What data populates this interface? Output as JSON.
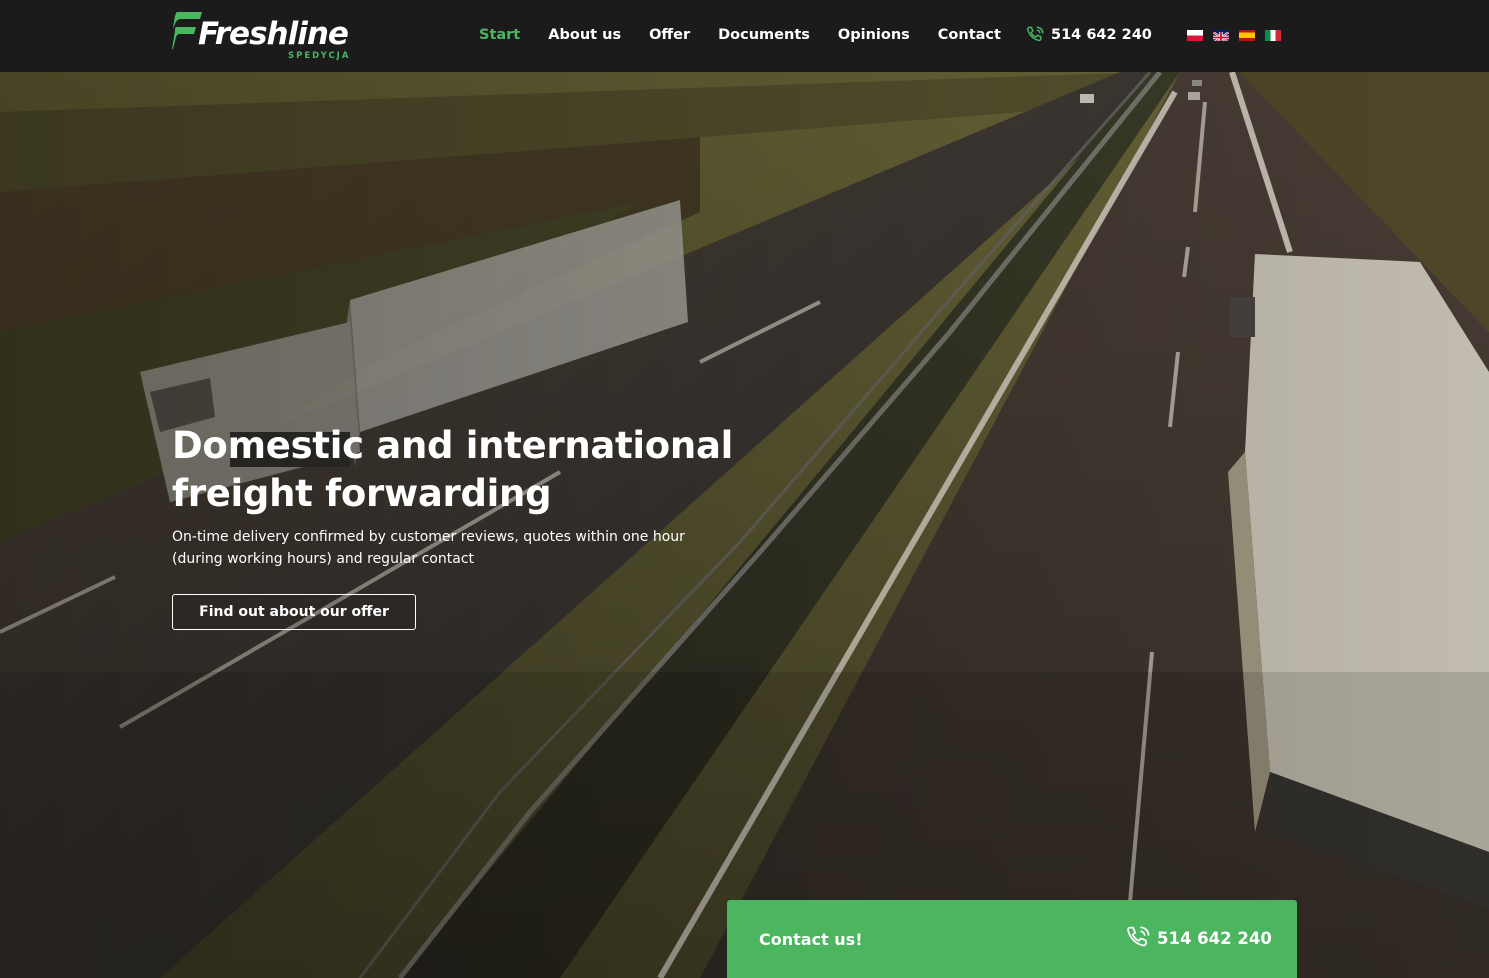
{
  "brand": {
    "name": "Freshline",
    "tagline": "SPEDYCJA",
    "accent_color": "#4bb55f",
    "header_bg": "#1b1b1b"
  },
  "nav": {
    "items": [
      {
        "label": "Start",
        "active": true
      },
      {
        "label": "About us",
        "active": false
      },
      {
        "label": "Offer",
        "active": false
      },
      {
        "label": "Documents",
        "active": false
      },
      {
        "label": "Opinions",
        "active": false
      },
      {
        "label": "Contact",
        "active": false
      }
    ]
  },
  "header_phone": {
    "icon": "phone-icon",
    "number": "514 642 240"
  },
  "languages": [
    {
      "code": "pl",
      "icon": "flag-pl-icon"
    },
    {
      "code": "gb",
      "icon": "flag-gb-icon"
    },
    {
      "code": "es",
      "icon": "flag-es-icon"
    },
    {
      "code": "it",
      "icon": "flag-it-icon"
    }
  ],
  "hero": {
    "title_line1": "Domestic and international",
    "title_line2": "freight forwarding",
    "subtitle_line1": "On-time delivery confirmed by customer reviews, quotes within one hour",
    "subtitle_line2": "(during working hours) and regular contact",
    "cta_label": "Find out about our offer",
    "background": "highway-with-trucks-photo"
  },
  "contact_bar": {
    "label": "Contact us!",
    "phone_icon": "phone-icon",
    "phone": "514 642 240",
    "bg_color": "#4bb55f"
  }
}
